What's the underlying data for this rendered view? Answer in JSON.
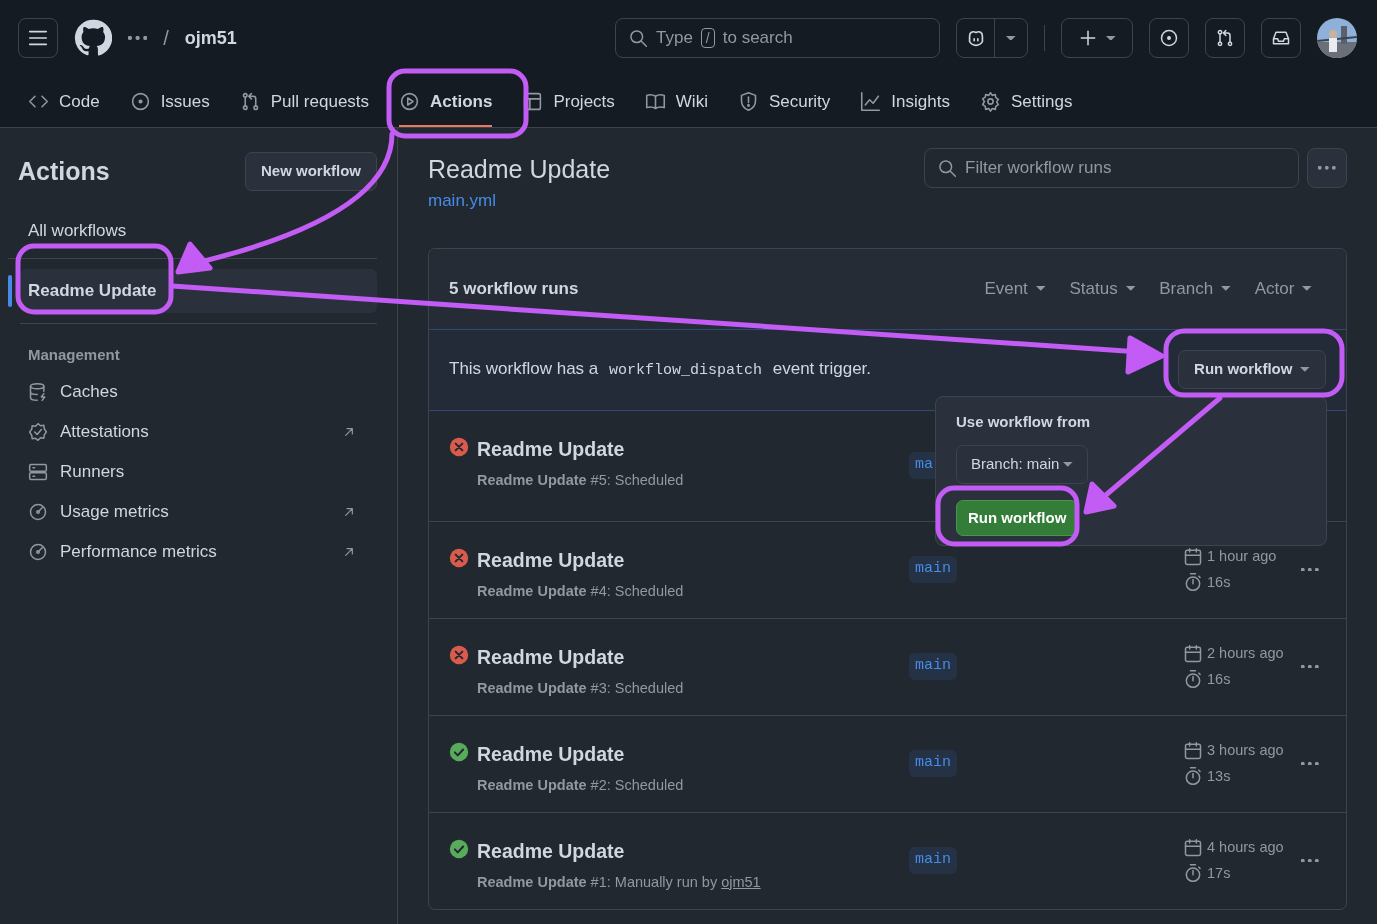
{
  "header": {
    "breadcrumb_separator": "/",
    "repo_owner": "ojm51",
    "search": {
      "before": "Type",
      "key": "/",
      "after": "to search"
    }
  },
  "repo_tabs": [
    {
      "label": "Code",
      "selected": false
    },
    {
      "label": "Issues",
      "selected": false
    },
    {
      "label": "Pull requests",
      "selected": false
    },
    {
      "label": "Actions",
      "selected": true
    },
    {
      "label": "Projects",
      "selected": false
    },
    {
      "label": "Wiki",
      "selected": false
    },
    {
      "label": "Security",
      "selected": false
    },
    {
      "label": "Insights",
      "selected": false
    },
    {
      "label": "Settings",
      "selected": false
    }
  ],
  "sidebar": {
    "title": "Actions",
    "new_button": "New workflow",
    "workflows": [
      {
        "label": "All workflows",
        "selected": false
      },
      {
        "label": "Readme Update",
        "selected": true
      }
    ],
    "section": "Management",
    "management": [
      {
        "label": "Caches",
        "external": false
      },
      {
        "label": "Attestations",
        "external": true
      },
      {
        "label": "Runners",
        "external": false
      },
      {
        "label": "Usage metrics",
        "external": true
      },
      {
        "label": "Performance metrics",
        "external": true
      }
    ]
  },
  "main": {
    "title": "Readme Update",
    "file": "main.yml",
    "filter_placeholder": "Filter workflow runs",
    "runs_count": "5 workflow runs",
    "filters": [
      "Event",
      "Status",
      "Branch",
      "Actor"
    ],
    "dispatch": {
      "before": "This workflow has a",
      "code": "workflow_dispatch",
      "after": "event trigger.",
      "button": "Run workflow"
    },
    "popover": {
      "title": "Use workflow from",
      "branch_button": "Branch: main",
      "run_button": "Run workflow"
    },
    "runs": [
      {
        "failed": true,
        "title": "Readme Update",
        "subtitle": "**Readme Update** #5: Scheduled",
        "branch": "ma"
      },
      {
        "failed": true,
        "title": "Readme Update",
        "subtitle": "**Readme Update** #4: Scheduled",
        "branch": "main",
        "date": "1 hour ago",
        "duration": "16s"
      },
      {
        "failed": true,
        "title": "Readme Update",
        "subtitle": "**Readme Update** #3: Scheduled",
        "branch": "main",
        "date": "2 hours ago",
        "duration": "16s"
      },
      {
        "failed": false,
        "title": "Readme Update",
        "subtitle": "**Readme Update** #2: Scheduled",
        "branch": "main",
        "date": "3 hours ago",
        "duration": "13s"
      },
      {
        "failed": false,
        "title": "Readme Update",
        "subtitle": "**Readme Update** #1: Manually run by",
        "actor": "ojm51",
        "branch": "main",
        "date": "4 hours ago",
        "duration": "17s"
      }
    ]
  }
}
